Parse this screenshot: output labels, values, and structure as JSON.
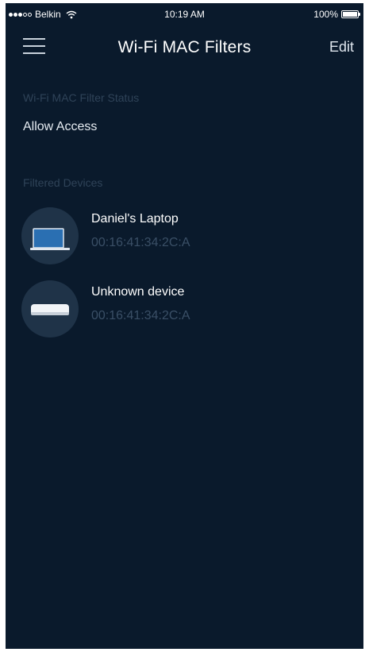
{
  "status_bar": {
    "carrier": "Belkin",
    "time": "10:19 AM",
    "battery": "100%",
    "battery_level": 1.0
  },
  "nav": {
    "title": "Wi-Fi MAC Filters",
    "edit_label": "Edit",
    "menu_icon": "hamburger-menu-icon"
  },
  "filter_status": {
    "label": "Wi-Fi MAC Filter Status",
    "value": "Allow Access"
  },
  "filtered_devices": {
    "label": "Filtered Devices",
    "items": [
      {
        "name": "Daniel's Laptop",
        "mac": "00:16:41:34:2C:A",
        "icon": "laptop-icon"
      },
      {
        "name": "Unknown device",
        "mac": "00:16:41:34:2C:A",
        "icon": "generic-device-icon"
      }
    ]
  },
  "colors": {
    "background": "#0a1a2c",
    "avatar": "#1f3348",
    "muted_label": "#2f4358",
    "mac_text": "#3a4f66"
  }
}
